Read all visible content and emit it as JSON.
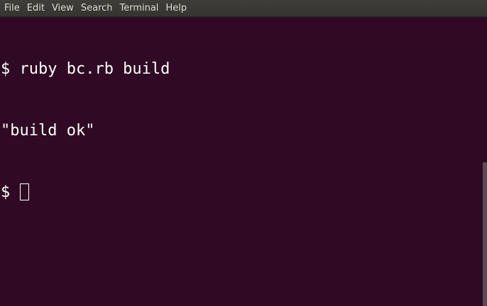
{
  "menu": {
    "items": [
      "File",
      "Edit",
      "View",
      "Search",
      "Terminal",
      "Help"
    ]
  },
  "terminal": {
    "lines": [
      "$ ruby bc.rb build",
      "\"build ok\""
    ],
    "prompt": "$ "
  },
  "colors": {
    "background": "#300a24",
    "text": "#ffffff",
    "menubar": "#3c3b37"
  }
}
